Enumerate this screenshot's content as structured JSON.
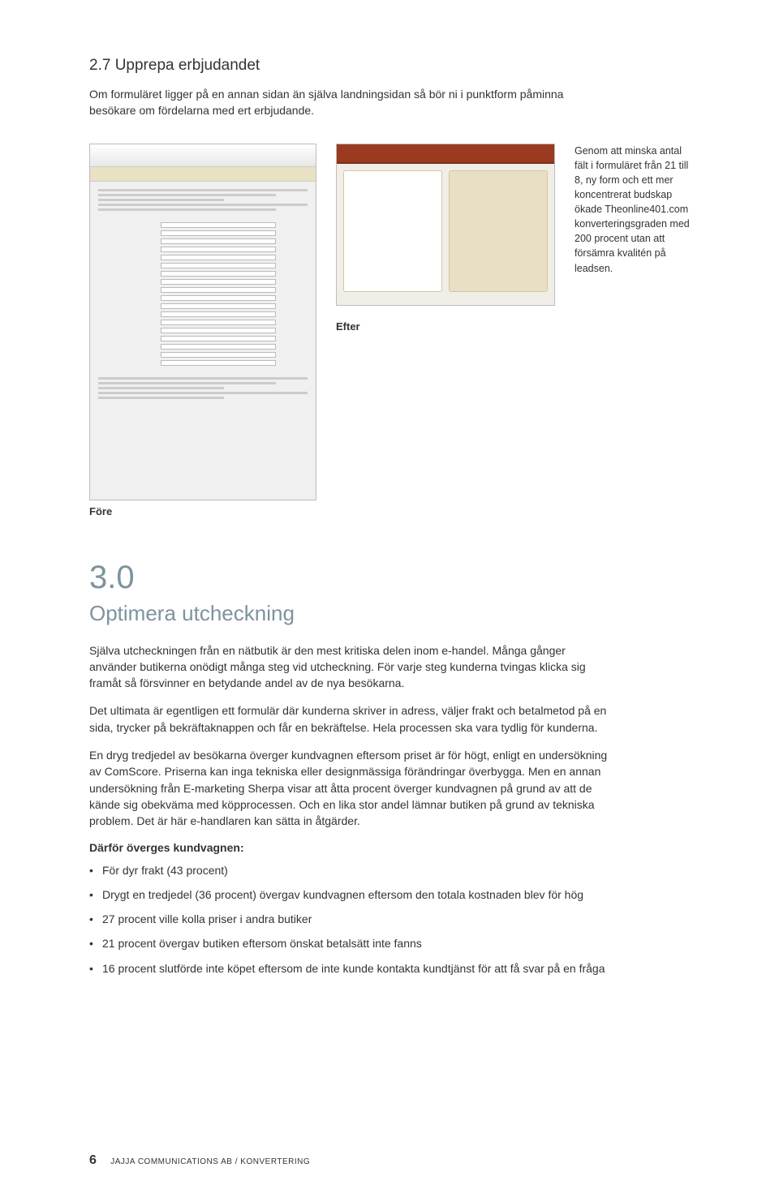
{
  "section27": {
    "heading": "2.7 Upprepa erbjudandet",
    "intro": "Om formuläret ligger på en annan sidan än själva landningsidan så bör ni i punktform påminna besökare om fördelarna med ert erbjudande."
  },
  "figures": {
    "before_caption": "Före",
    "after_caption": "Efter",
    "sidebar": "Genom att minska antal fält i formuläret från 21 till 8, ny form och ett mer koncentrerat budskap ökade Theonline401.com konverteringsgraden med 200 procent utan att försämra kvalitén på leadsen."
  },
  "section30": {
    "number": "3.0",
    "title": "Optimera utcheckning",
    "p1": "Själva utcheckningen från en nätbutik är den mest kritiska delen inom e-handel. Många gånger använder butikerna onödigt många steg vid utcheckning. För varje steg kunderna tvingas klicka sig framåt så försvinner en betydande andel av de nya besökarna.",
    "p2": "Det ultimata är egentligen ett formulär där kunderna skriver in adress, väljer frakt och betalmetod på en sida, trycker på bekräftaknappen och får en bekräftelse. Hela processen ska vara tydlig för kunderna.",
    "p3": "En dryg tredjedel av besökarna överger kundvagnen eftersom priset är för högt, enligt en undersökning av ComScore. Priserna kan inga tekniska eller designmässiga förändringar överbygga. Men en annan undersökning från E-marketing Sherpa visar att åtta procent överger kundvagnen på grund av att de kände sig obekväma med köpprocessen. Och en lika stor andel lämnar butiken på grund av tekniska problem. Det är här e-handlaren kan sätta in åtgärder.",
    "subhead": "Därför överges kundvagnen:",
    "bullets": [
      "För dyr frakt (43 procent)",
      "Drygt en tredjedel (36 procent) övergav kundvagnen eftersom den totala kostnaden blev för hög",
      "27 procent ville kolla priser i andra butiker",
      "21 procent övergav butiken eftersom önskat betalsätt inte fanns",
      "16 procent slutförde inte köpet eftersom de inte kunde kontakta kundtjänst för att få svar på en fråga"
    ]
  },
  "footer": {
    "page": "6",
    "line": "JAJJA COMMUNICATIONS AB / KONVERTERING"
  }
}
